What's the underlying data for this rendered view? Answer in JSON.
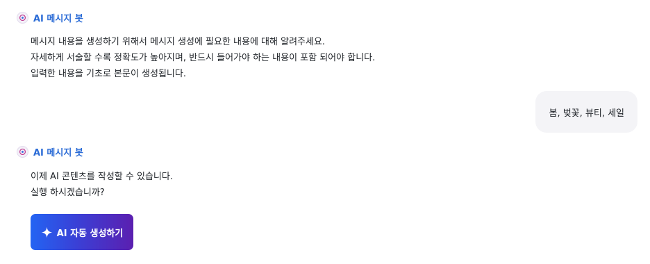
{
  "bot_name": "AI 메시지 봇",
  "messages": [
    {
      "role": "bot",
      "lines": [
        "메시지 내용을 생성하기 위해서 메시지 생성에 필요한 내용에 대해 알려주세요.",
        "자세하게 서술할 수록 정확도가 높아지며, 반드시 들어가야 하는 내용이 포함 되어야 합니다.",
        "입력한 내용을 기초로 본문이 생성됩니다."
      ]
    },
    {
      "role": "user",
      "text": "봄, 벚꽃, 뷰티, 세일"
    },
    {
      "role": "bot",
      "lines": [
        "이제 AI 콘텐츠를 작성할 수 있습니다.",
        "실행 하시겠습니까?"
      ]
    }
  ],
  "action_button": {
    "label": "AI 자동 생성하기",
    "icon": "sparkle-icon"
  },
  "colors": {
    "bot_name": "#2a6bd6",
    "text": "#1f2328",
    "user_bubble_bg": "#f4f4f7",
    "button_gradient_start": "#2364f3",
    "button_gradient_end": "#5b1fb0"
  }
}
